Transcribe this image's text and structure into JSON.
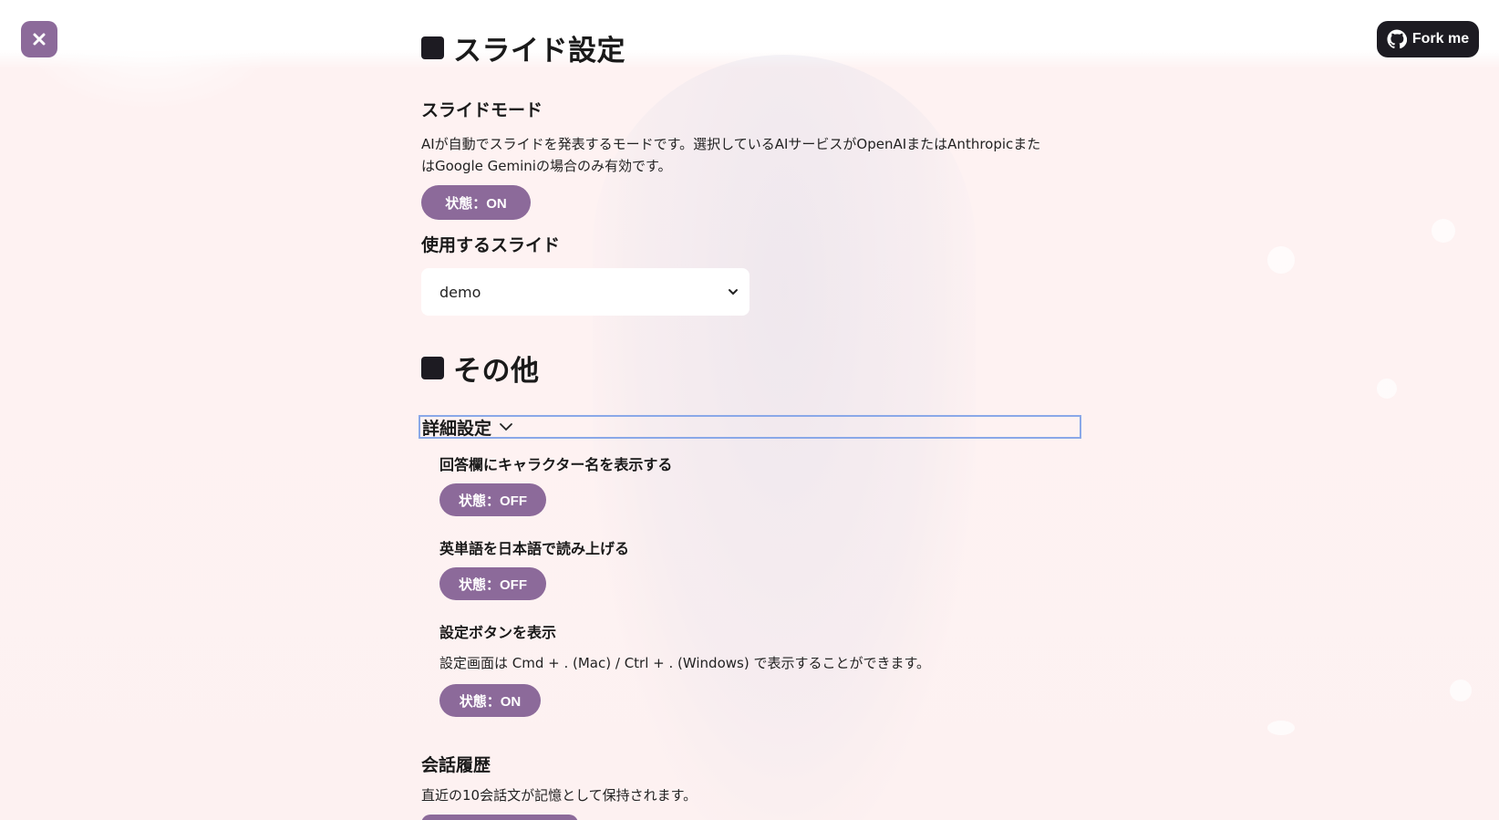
{
  "header": {
    "close_icon": "close-icon",
    "fork_label": "Fork me",
    "fork_icon": "github-icon"
  },
  "slide_section": {
    "title": "スライド設定",
    "slide_mode": {
      "heading": "スライドモード",
      "description_line1": "AIが自動でスライドを発表するモードです。選択しているAIサービスがOpenAIまたはAnthropicまた",
      "description_line2": "はGoogle Geminiの場合のみ有効です。",
      "toggle_label": "状態：ON"
    },
    "slide_select": {
      "heading": "使用するスライド",
      "selected_value": "demo"
    }
  },
  "other_section": {
    "title": "その他",
    "advanced": {
      "summary_label": "詳細設定",
      "show_character_name": {
        "heading": "回答欄にキャラクター名を表示する",
        "toggle_label": "状態：OFF"
      },
      "english_to_japanese": {
        "heading": "英単語を日本語で読み上げる",
        "toggle_label": "状態：OFF"
      },
      "show_settings_button": {
        "heading": "設定ボタンを表示",
        "description": "設定画面は Cmd + . (Mac) / Ctrl + . (Windows) で表示することができます。",
        "toggle_label": "状態：ON"
      }
    },
    "history": {
      "heading": "会話履歴",
      "description": "直近の10会話文が記憶として保持されます。"
    }
  },
  "colors": {
    "accent": "#8c6a9a",
    "dark": "#1d1b22",
    "focus_outline": "#8aa8e8",
    "background": "#fdeded"
  }
}
